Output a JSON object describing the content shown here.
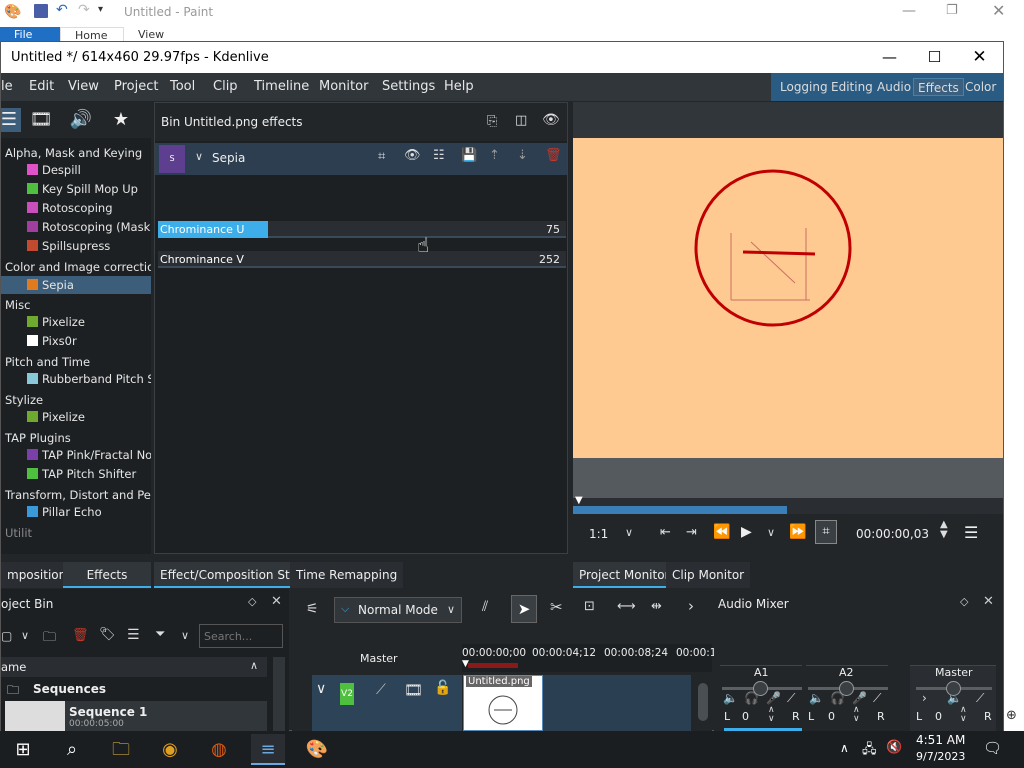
{
  "paint": {
    "title": "Untitled - Paint",
    "tabs": [
      "File",
      "Home",
      "View"
    ]
  },
  "kdenlive": {
    "title": "Untitled */ 614x460 29.97fps - Kdenlive",
    "menu": [
      "le",
      "Edit",
      "View",
      "Project",
      "Tool",
      "Clip",
      "Timeline",
      "Monitor",
      "Settings",
      "Help"
    ],
    "layouts": [
      "Logging",
      "Editing",
      "Audio",
      "Effects",
      "Color"
    ],
    "active_layout": "Effects"
  },
  "effects_tree": {
    "categories": [
      {
        "name": "Alpha, Mask and Keying",
        "items": [
          {
            "label": "Despill",
            "color": "#e052c8"
          },
          {
            "label": "Key Spill Mop Up",
            "color": "#4fbf3f"
          },
          {
            "label": "Rotoscoping",
            "color": "#c94fbd"
          },
          {
            "label": "Rotoscoping (Mask)",
            "color": "#a23ea0"
          },
          {
            "label": "Spillsupress",
            "color": "#c24a2e"
          }
        ]
      },
      {
        "name": "Color and Image correction",
        "items": [
          {
            "label": "Sepia",
            "color": "#e07a1f",
            "selected": true
          }
        ]
      },
      {
        "name": "Misc",
        "items": [
          {
            "label": "Pixelize",
            "color": "#6faa2f"
          },
          {
            "label": "Pixs0r",
            "color": "#ffffff"
          }
        ]
      },
      {
        "name": "Pitch and Time",
        "items": [
          {
            "label": "Rubberband Pitch Scal",
            "color": "#88c8d8"
          }
        ]
      },
      {
        "name": "Stylize",
        "items": [
          {
            "label": "Pixelize",
            "color": "#6faa2f"
          }
        ]
      },
      {
        "name": "TAP Plugins",
        "items": [
          {
            "label": "TAP Pink/Fractal Noise",
            "color": "#7a3fa8"
          },
          {
            "label": "TAP Pitch Shifter",
            "color": "#4fbf3f"
          }
        ]
      },
      {
        "name": "Transform, Distort and Perspe",
        "items": [
          {
            "label": "Pillar Echo",
            "color": "#3a9ad9"
          }
        ]
      }
    ],
    "partial_bottom": "Utilit"
  },
  "effects_panel": {
    "title": "Bin Untitled.png effects",
    "effect_name": "Sepia",
    "effect_badge": "S",
    "params": [
      {
        "label": "Chrominance U",
        "value": "75",
        "fraction": 0.27
      },
      {
        "label": "Chrominance V",
        "value": "252",
        "fraction": 0.0
      }
    ]
  },
  "monitor": {
    "zoom": "1:1",
    "timecode": "00:00:00,03"
  },
  "tabs_row": {
    "left": [
      "mpositions",
      "Effects"
    ],
    "center": [
      "Effect/Composition Stack",
      "Time Remapping"
    ],
    "right": [
      "Project Monitor",
      "Clip Monitor"
    ]
  },
  "project_bin": {
    "title": "oject Bin",
    "search_placeholder": "Search...",
    "column": "ame",
    "folder": "Sequences",
    "sequence": "Sequence 1",
    "sequence_dur": "00:00:05:00",
    "clip": "Untitled.png"
  },
  "timeline": {
    "mode": "Normal Mode",
    "master": "Master",
    "ticks": [
      "00:00:00;00",
      "00:00:04;12",
      "00:00:08;24",
      "00:00:1"
    ],
    "track": "V2",
    "clip": "Untitled.png"
  },
  "mixer": {
    "title": "Audio Mixer",
    "channels": [
      "A1",
      "A2",
      "Master"
    ],
    "gain_values": [
      "0",
      "0",
      "0"
    ],
    "l": "L",
    "r": "R"
  },
  "taskbar": {
    "time": "4:51 AM",
    "date": "9/7/2023"
  }
}
